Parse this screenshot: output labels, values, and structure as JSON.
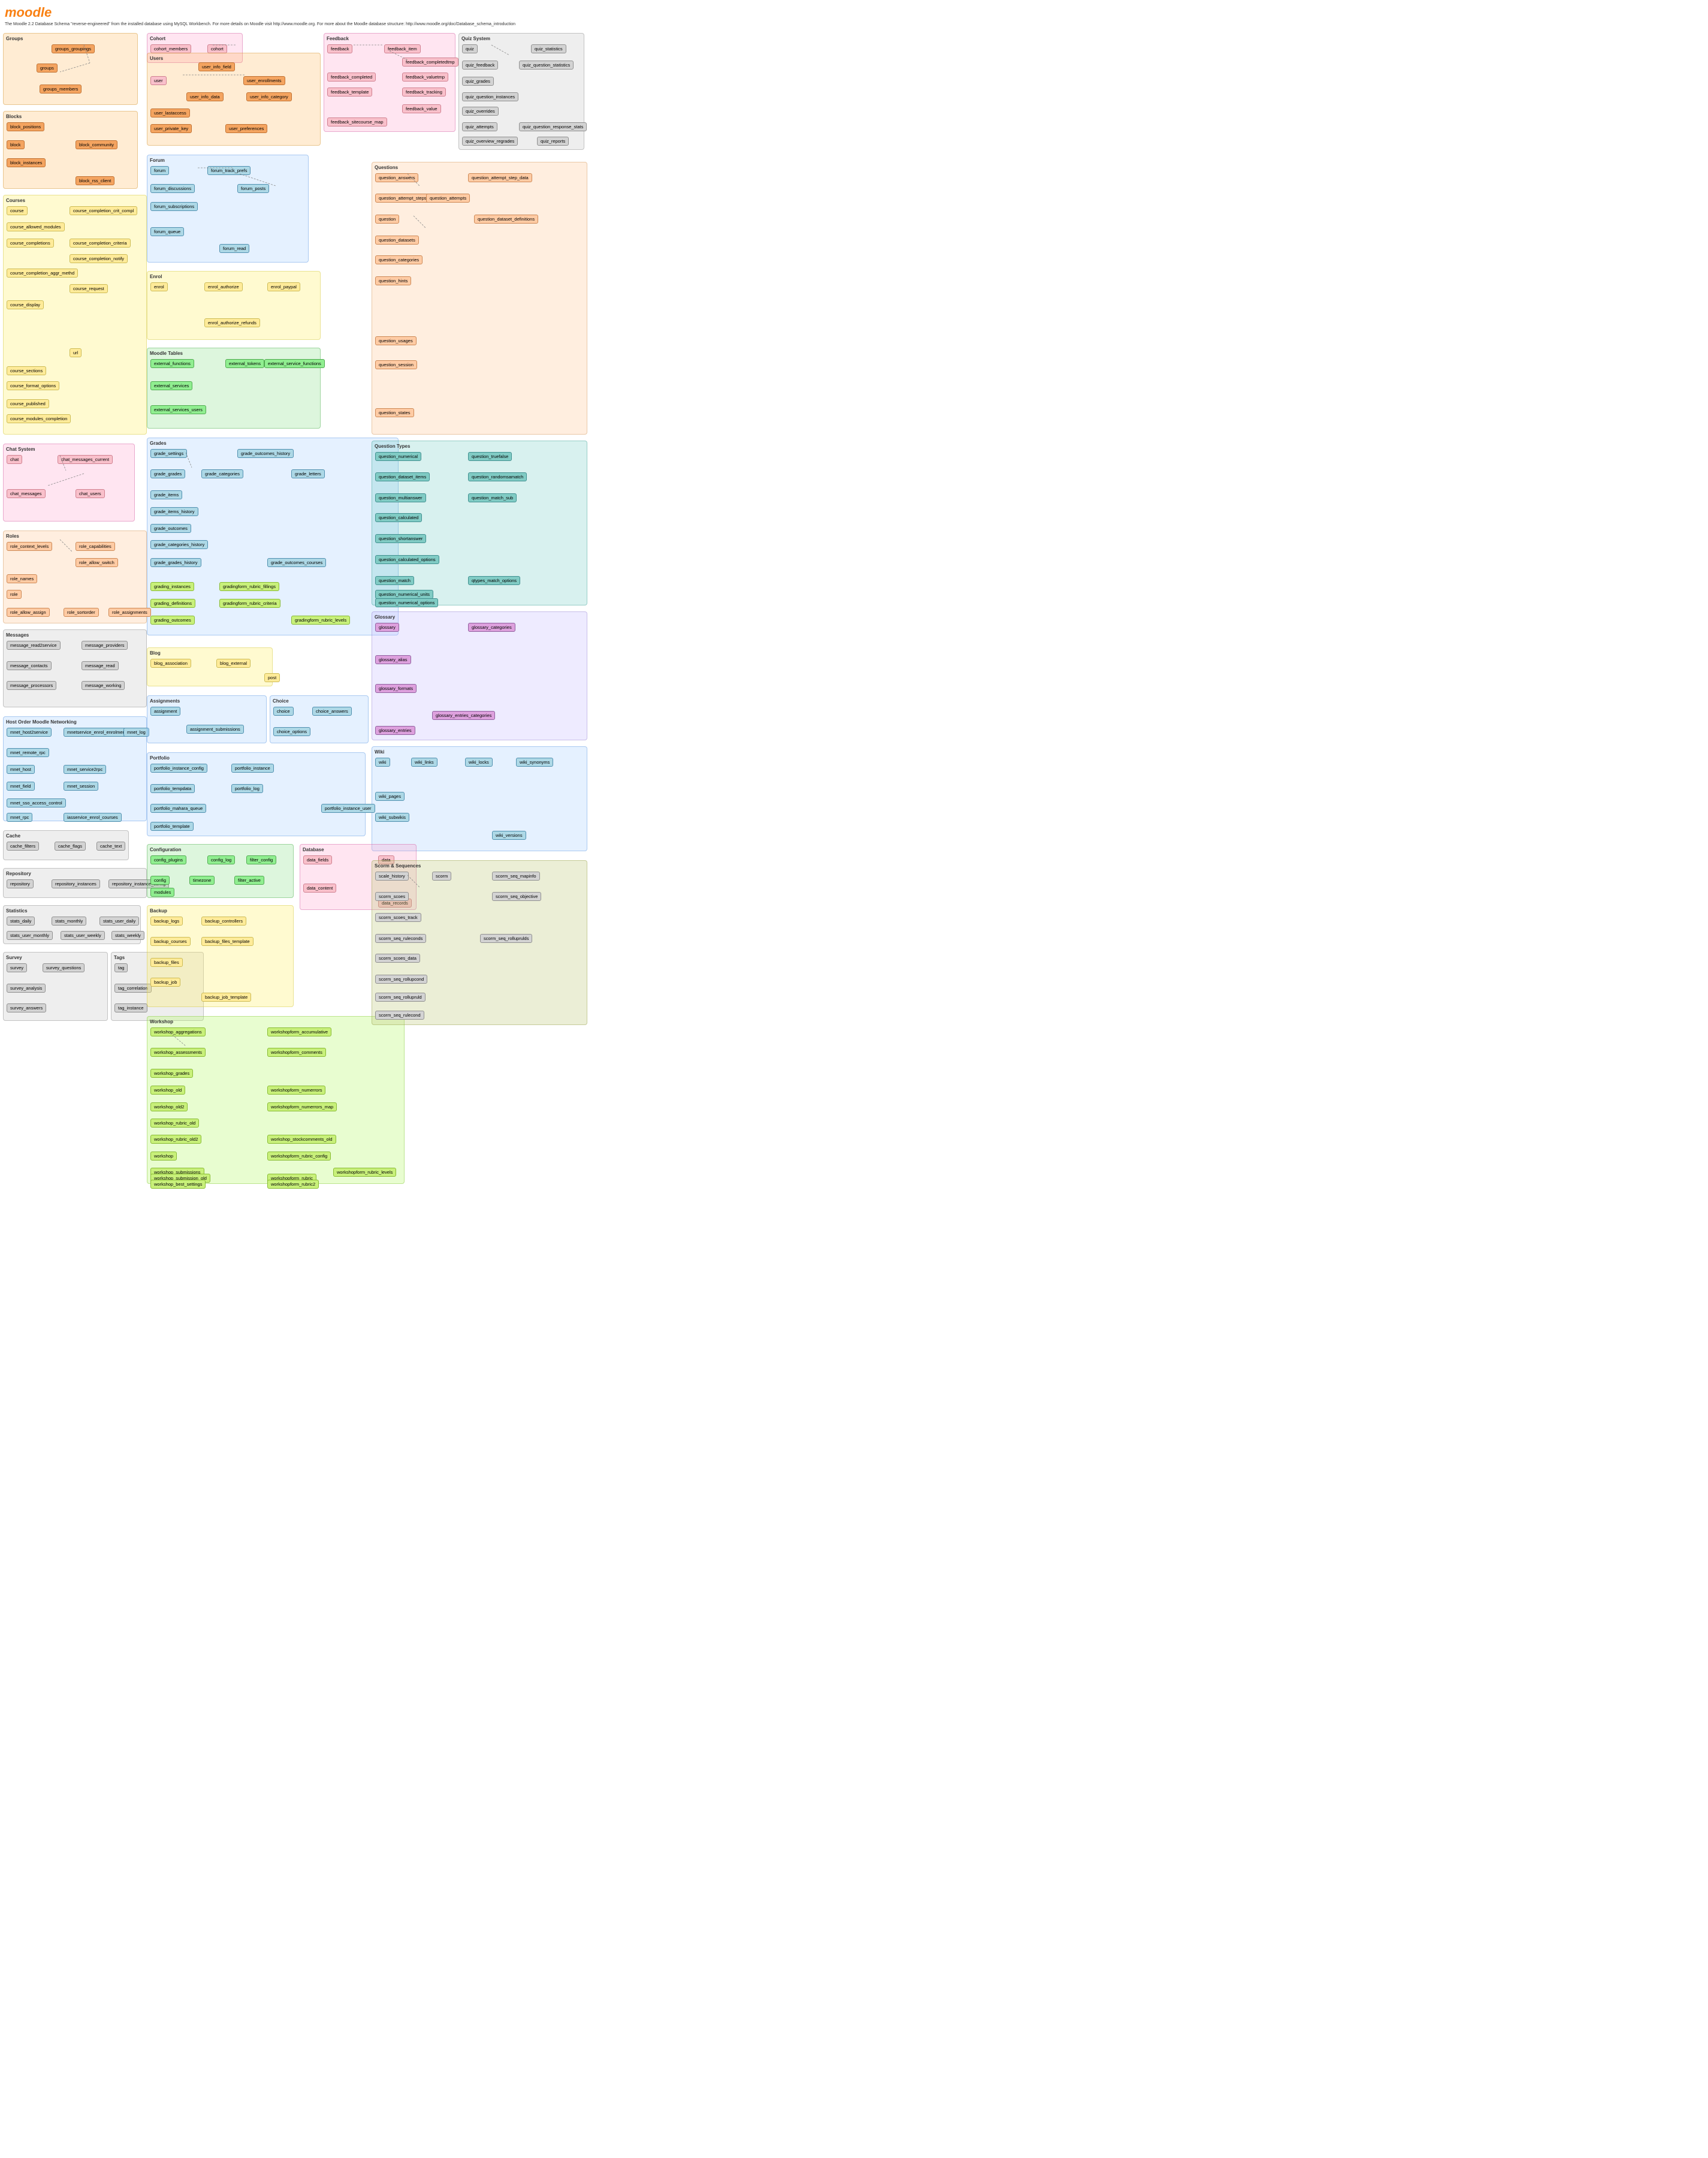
{
  "app": {
    "name": "moodle",
    "logo": "moodle",
    "info": "The Moodle 2.2 Database Schema \"reverse-engineered\" from the installed database using\nMySQL Workbench.\nFor more details on Moodle visit http://www.moodle.org.\nFor more about the Moodle database structure:\nhttp://www.moodle.org/doc/Database_schema_introduction"
  },
  "sections": {
    "groups": {
      "title": "Groups",
      "color": "bg-orange"
    },
    "blocks": {
      "title": "Blocks",
      "color": "bg-orange"
    },
    "courses": {
      "title": "Courses",
      "color": "bg-yellow"
    },
    "cohort": {
      "title": "Cohort",
      "color": "bg-pink"
    },
    "users": {
      "title": "Users",
      "color": "bg-orange"
    },
    "feedback": {
      "title": "Feedback",
      "color": "bg-pink"
    },
    "quiz_system": {
      "title": "Quiz System",
      "color": "bg-gray"
    },
    "forum": {
      "title": "Forum",
      "color": "bg-blue"
    },
    "enrol": {
      "title": "Enrol",
      "color": "bg-yellow"
    },
    "moodle_tables": {
      "title": "Moodle Tables",
      "color": "bg-green"
    },
    "grades": {
      "title": "Grades",
      "color": "bg-blue"
    },
    "messages": {
      "title": "Messages",
      "color": "bg-gray"
    },
    "chat": {
      "title": "Chat System",
      "color": "bg-pink"
    },
    "roles": {
      "title": "Roles",
      "color": "bg-peach"
    },
    "questions": {
      "title": "Questions",
      "color": "bg-peach"
    },
    "question_types": {
      "title": "Question Types",
      "color": "bg-teal"
    },
    "glossary": {
      "title": "Glossary",
      "color": "bg-lavender"
    },
    "wiki": {
      "title": "Wiki",
      "color": "bg-blue"
    },
    "blog": {
      "title": "Blog",
      "color": "bg-yellow"
    },
    "assignments": {
      "title": "Assignments",
      "color": "bg-blue"
    },
    "choice": {
      "title": "Choice",
      "color": "bg-blue"
    },
    "portfolio": {
      "title": "Portfolio",
      "color": "bg-blue"
    },
    "configuration": {
      "title": "Configuration",
      "color": "bg-green"
    },
    "database": {
      "title": "Database",
      "color": "bg-pink"
    },
    "backup": {
      "title": "Backup",
      "color": "bg-yellow"
    },
    "workshop": {
      "title": "Workshop",
      "color": "bg-lime"
    },
    "scorm": {
      "title": "Scorm & Sequences",
      "color": "bg-olive"
    },
    "cache": {
      "title": "Cache",
      "color": "bg-gray"
    },
    "repository": {
      "title": "Repository",
      "color": "bg-gray"
    },
    "statistics": {
      "title": "Statistics",
      "color": "bg-gray"
    },
    "survey": {
      "title": "Survey",
      "color": "bg-gray"
    },
    "tags": {
      "title": "Tags",
      "color": "bg-gray"
    },
    "mnet": {
      "title": "Host Order Moodle Networking",
      "color": "bg-blue"
    }
  },
  "tables": {
    "groups_groupings": "groups_groupings",
    "groups": "groups",
    "groups_members": "groups_members",
    "cohort_members": "cohort_members",
    "cohort": "cohort",
    "block_positions": "block_positions",
    "block": "block",
    "block_community": "block_community",
    "block_instances": "block_instances",
    "block_rss_client": "block_rss_client",
    "user_info_field": "user_info_field",
    "user": "user",
    "user_enrollments": "user_enrollments",
    "user_info_data": "user_info_data",
    "user_info_category": "user_info_category",
    "user_lastaccess": "user_lastaccess",
    "user_private_key": "user_private_key",
    "user_preferences": "user_preferences",
    "feedback": "feedback",
    "feedback_item": "feedback_item",
    "feedback_completedtmp": "feedback_completedtmp",
    "feedback_valuetmp": "feedback_valuetmp",
    "feedback_tracking": "feedback_tracking",
    "feedback_completed": "feedback_completed",
    "feedback_template": "feedback_template",
    "feedback_value": "feedback_value",
    "feedback_sitecourse_map": "feedback_sitecourse_map",
    "quiz": "quiz",
    "quiz_statistics": "quiz_statistics",
    "quiz_feedback": "quiz_feedback",
    "quiz_question_statistics": "quiz_question_statistics",
    "quiz_grades": "quiz_grades",
    "quiz_question_instances": "quiz_question_instances",
    "quiz_overrides": "quiz_overrides",
    "quiz_attempts": "quiz_attempts",
    "quiz_question_response_stats": "quiz_question_response_stats",
    "quiz_reports": "quiz_reports",
    "quiz_overview_regrades": "quiz_overview_regrades",
    "course": "course",
    "course_completion_crit_compl": "course_completion_crit_compl",
    "course_allowed_modules": "course_allowed_modules",
    "course_completion_criteria": "course_completion_criteria",
    "course_completions": "course_completions",
    "course_completion_notify": "course_completion_notify",
    "course_completion_aggr_methd": "course_completion_aggr_methd",
    "course_request": "course_request",
    "course_display": "course_display",
    "course_published": "course_published",
    "course_sections": "course_sections",
    "course_format_options": "course_format_options",
    "url": "url",
    "course_modules_completion": "course_modules_completion",
    "forum": "forum",
    "forum_track_prefs": "forum_track_prefs",
    "forum_discussions": "forum_discussions",
    "forum_posts": "forum_posts",
    "forum_subscriptions": "forum_subscriptions",
    "forum_queue": "forum_queue",
    "forum_read": "forum_read",
    "enrol": "enrol",
    "enrol_authorize": "enrol_authorize",
    "enrol_paypal": "enrol_paypal",
    "enrol_authorize_refunds": "enrol_authorize_refunds",
    "external_functions": "external_functions",
    "external_tokens": "external_tokens",
    "external_service_functions": "external_service_functions",
    "external_services": "external_services",
    "external_services_users": "external_services_users",
    "grade_settings": "grade_settings",
    "grade_outcomes_history": "grade_outcomes_history",
    "grade_grades": "grade_grades",
    "grade_categories": "grade_categories",
    "grade_letters": "grade_letters",
    "grade_items": "grade_items",
    "grade_items_history": "grade_items_history",
    "grade_outcomes": "grade_outcomes",
    "grade_categories_history": "grade_categories_history",
    "grade_outcomes_courses": "grade_outcomes_courses",
    "grade_grades_history": "grade_grades_history",
    "grading_instances": "grading_instances",
    "gradingform_rubric_fillings": "gradingform_rubric_fillings",
    "grading_definitions": "grading_definitions",
    "gradingform_rubric_criteria": "gradingform_rubric_criteria",
    "grading_outcomes": "grading_outcomes",
    "gradingform_rubric_levels": "gradingform_rubric_levels",
    "chat": "chat",
    "chat_messages_current": "chat_messages_current",
    "chat_messages": "chat_messages",
    "chat_users": "chat_users",
    "role_context_levels": "role_context_levels",
    "role_capabilities": "role_capabilities",
    "role_allow_switch": "role_allow_switch",
    "role_names": "role_names",
    "role": "role",
    "role_allow_assign": "role_allow_assign",
    "role_sortorder": "role_sortorder",
    "role_assignments": "role_assignments",
    "message_read2service": "message_read2service",
    "message_providers": "message_providers",
    "message_contacts": "message_contacts",
    "message_read": "message_read",
    "message_processors": "message_processors",
    "message_working": "message_working",
    "mnet_host2service": "mnet_host2service",
    "mnetservice_enrol_enrolments": "mnetservice_enrol_enrolments",
    "mnet_log": "mnet_log",
    "mnet_remote_rpc": "mnet_remote_rpc",
    "mnet_host": "mnet_host",
    "mnet_service2rpc": "mnet_service2rpc",
    "mnet_field": "mnet_field",
    "mnet_session": "mnet_session",
    "mnet_sso_access_control": "mnet_sso_access_control",
    "mnet_rpc": "mnet_rpc",
    "iasservice_enrol_courses": "iasservice_enrol_courses",
    "question_answers": "question_answers",
    "question_attempt_step_data": "question_attempt_step_data",
    "question_attempt_steps": "question_attempt_steps",
    "question": "question",
    "question_attempts": "question_attempts",
    "question_dataset_definitions": "question_dataset_definitions",
    "question_datasets": "question_datasets",
    "question_categories": "question_categories",
    "question_hints": "question_hints",
    "question_usages": "question_usages",
    "question_session": "question_session",
    "question_states": "question_states",
    "question_numerical": "question_numerical",
    "question_truefalse": "question_truefalse",
    "question_dataset_items": "question_dataset_items",
    "question_randomsamatch": "question_randomsamatch",
    "question_multianswer": "question_multianswer",
    "question_match_sub": "question_match_sub",
    "question_calculated": "question_calculated",
    "question_shortanswer": "question_shortanswer",
    "question_calculated_options": "question_calculated_options",
    "question_match": "question_match",
    "qtypes_match_options": "qtypes_match_options",
    "question_numerical_units": "question_numerical_units",
    "question_numerical_options": "question_numerical_options",
    "glossary": "glossary",
    "glossary_categories": "glossary_categories",
    "glossary_alias": "glossary_alias",
    "glossary_formats": "glossary_formats",
    "glossary_entries_categories": "glossary_entries_categories",
    "glossary_entries": "glossary_entries",
    "wiki": "wiki",
    "wiki_links": "wiki_links",
    "wiki_locks": "wiki_locks",
    "wiki_synonyms": "wiki_synonyms",
    "wiki_pages": "wiki_pages",
    "wiki_subwikis": "wiki_subwikis",
    "wiki_versions": "wiki_versions",
    "blog_association": "blog_association",
    "blog_external": "blog_external",
    "post": "post",
    "assignment": "assignment",
    "assignment_submissions": "assignment_submissions",
    "choice": "choice",
    "choice_answers": "choice_answers",
    "choice_options": "choice_options",
    "portfolio_instance_config": "portfolio_instance_config",
    "portfolio_instance": "portfolio_instance",
    "portfolio_tempdata": "portfolio_tempdata",
    "portfolio_log": "portfolio_log",
    "portfolio_mahara_queue": "portfolio_mahara_queue",
    "portfolio_instance_user": "portfolio_instance_user",
    "portfolio_template": "portfolio_template",
    "config_plugins": "config_plugins",
    "config_log": "config_log",
    "filter_config": "filter_config",
    "config": "config",
    "timezone": "timezone",
    "filter_active": "filter_active",
    "modules": "modules",
    "data_fields": "data_fields",
    "data": "data",
    "data_content": "data_content",
    "data_records": "data_records",
    "backup_logs": "backup_logs",
    "backup_controllers": "backup_controllers",
    "backup_courses": "backup_courses",
    "backup_files_template": "backup_files_template",
    "backup_files": "backup_files",
    "backup_job": "backup_job",
    "backup_job_template": "backup_job_template",
    "workshopform_accumulative": "workshopform_accumulative",
    "workshop_aggregations": "workshop_aggregations",
    "workshop_assessments": "workshop_assessments",
    "workshopform_comments": "workshopform_comments",
    "workshop_grades": "workshop_grades",
    "workshop_old": "workshop_old",
    "workshopform_numerrors": "workshopform_numerrors",
    "workshop_old2": "workshop_old2",
    "workshopform_numerrors_map": "workshopform_numerrors_map",
    "workshop_rubric_old": "workshop_rubric_old",
    "workshop_rubric_old2": "workshop_rubric_old2",
    "workshop": "workshop",
    "workshop_submissions": "workshop_submissions",
    "workshopform_rubric_config": "workshopform_rubric_config",
    "workshop_stockcomments_old": "workshop_stockcomments_old",
    "workshopform_rubric_levels": "workshopform_rubric_levels",
    "workshop_submission_old": "workshop_submission_old",
    "workshopform_rubric": "workshopform_rubric",
    "workshop_best_settings": "workshop_best_settings",
    "workshopform_rubric2": "workshopform_rubric2",
    "scale_history": "scale_history",
    "scorm": "scorm",
    "scorm_seq_mapinfo": "scorm_seq_mapinfo",
    "scorm_scoes": "scorm_scoes",
    "scorm_seq_objective": "scorm_seq_objective",
    "scorm_scoes_track": "scorm_scoes_track",
    "scorm_seq_ruleconds": "scorm_seq_ruleconds",
    "scorm_seq_rolluprulds": "scorm_seq_rolluprulds",
    "scorm_scoes_data": "scorm_scoes_data",
    "scorm_seq_rollupcond": "scorm_seq_rollupcond",
    "scorm_seq_rollupruld": "scorm_seq_rollupruld",
    "scorm_seq_rulecond": "scorm_seq_rulecond",
    "cache_filters": "cache_filters",
    "cache_flags": "cache_flags",
    "cache_text": "cache_text",
    "repository": "repository",
    "repository_instances": "repository_instances",
    "repository_instance_config": "repository_instance_config",
    "stats_daily": "stats_daily",
    "stats_monthly": "stats_monthly",
    "stats_user_daily": "stats_user_daily",
    "stats_user_monthly": "stats_user_monthly",
    "stats_user_weekly": "stats_user_weekly",
    "stats_weekly": "stats_weekly",
    "survey": "survey",
    "survey_questions": "survey_questions",
    "survey_analysis": "survey_analysis",
    "survey_answers": "survey_answers",
    "tag": "tag",
    "tag_correlation": "tag_correlation",
    "tag_instance": "tag_instance"
  }
}
